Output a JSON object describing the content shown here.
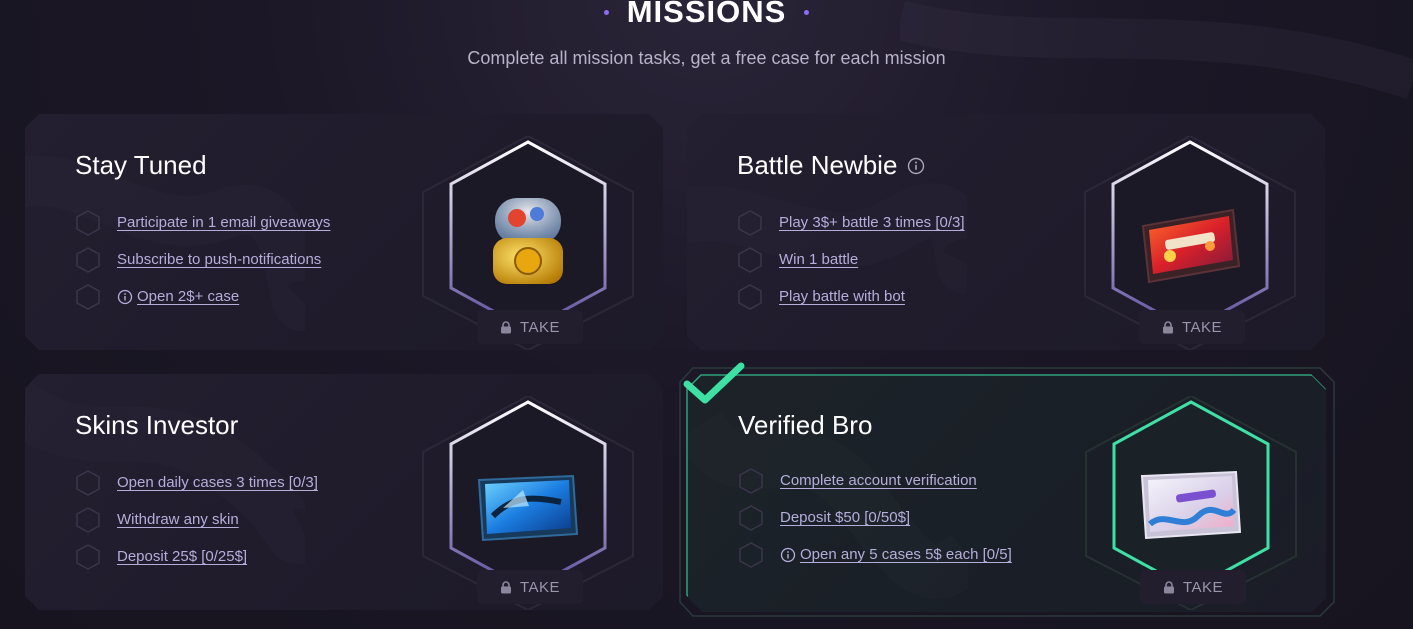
{
  "header": {
    "title": "MISSIONS",
    "subtitle": "Complete all mission tasks, get a free case for each mission"
  },
  "colors": {
    "accent_purple": "#8e6cff",
    "task_link": "#b5aedb",
    "verified_green": "#3ee0a4"
  },
  "missions": [
    {
      "title": "Stay Tuned",
      "has_info": false,
      "tasks": [
        {
          "label": "Participate in 1 email giveaways",
          "info": false
        },
        {
          "label": "Subscribe to push-notifications",
          "info": false
        },
        {
          "label": "Open 2$+ case",
          "info": true
        }
      ],
      "take_label": "TAKE",
      "reward_image": "golden-capsule-case",
      "completed": false
    },
    {
      "title": "Battle Newbie",
      "has_info": true,
      "tasks": [
        {
          "label": "Play 3$+ battle 3 times [0/3]",
          "info": false
        },
        {
          "label": "Win 1 battle",
          "info": false
        },
        {
          "label": "Play battle with bot",
          "info": false
        }
      ],
      "take_label": "TAKE",
      "reward_image": "fire-weapon-case",
      "completed": false
    },
    {
      "title": "Skins Investor",
      "has_info": false,
      "tasks": [
        {
          "label": "Open daily cases 3 times [0/3]",
          "info": false
        },
        {
          "label": "Withdraw any skin",
          "info": false
        },
        {
          "label": "Deposit 25$ [0/25$]",
          "info": false
        }
      ],
      "take_label": "TAKE",
      "reward_image": "blue-shark-weapon-case",
      "completed": false
    },
    {
      "title": "Verified Bro",
      "has_info": false,
      "tasks": [
        {
          "label": "Complete account verification",
          "info": false
        },
        {
          "label": "Deposit $50 [0/50$]",
          "info": false
        },
        {
          "label": "Open any 5 cases 5$ each [0/5]",
          "info": true
        }
      ],
      "take_label": "TAKE",
      "reward_image": "white-wave-weapon-case",
      "completed": true
    }
  ]
}
